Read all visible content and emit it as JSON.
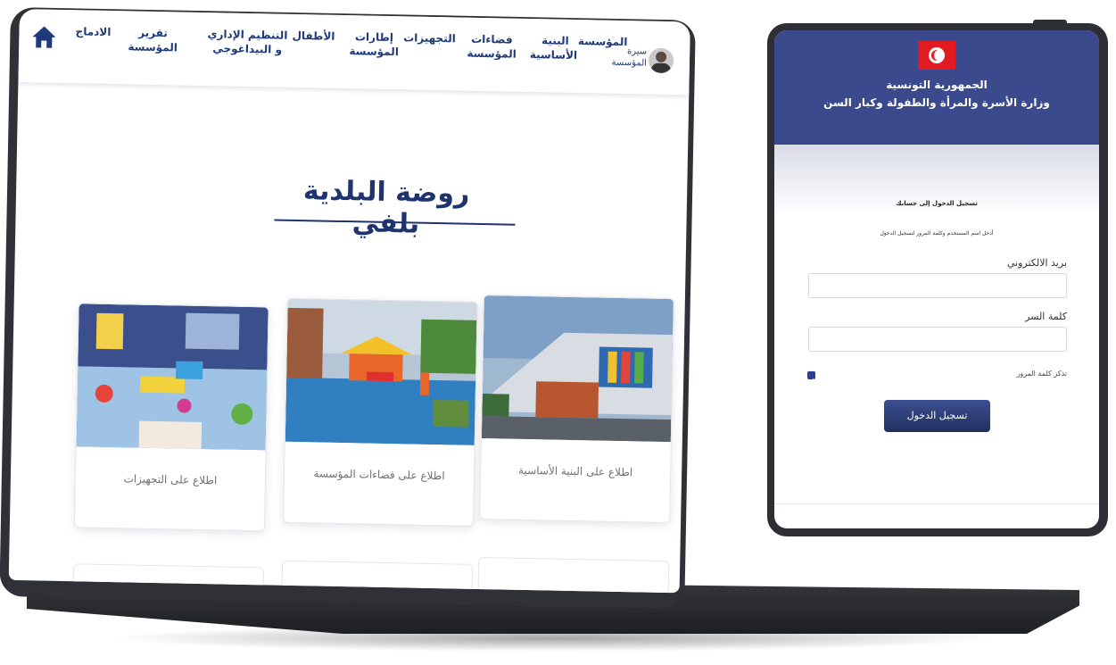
{
  "nav": {
    "items": [
      {
        "label": "الادماج"
      },
      {
        "label": "تقرير المؤسسة"
      },
      {
        "label": "التنظيم الإداري و البيداغوجي"
      },
      {
        "label": "الأطفال"
      },
      {
        "label": "إطارات المؤسسة"
      },
      {
        "label": "التجهيزات"
      },
      {
        "label": "فضاءات المؤسسة"
      },
      {
        "label": "البنية الأساسية"
      },
      {
        "label": "المؤسسة"
      }
    ],
    "user_name": "سيرة المؤسسة"
  },
  "page": {
    "title": "روضة البلدية بلفي"
  },
  "cards": [
    {
      "label": "اطلاع على التجهيزات"
    },
    {
      "label": "اطلاع على فضاءات المؤسسة"
    },
    {
      "label": "اطلاع على البنية الأساسية"
    }
  ],
  "login": {
    "republic": "الجمهورية التونسية",
    "ministry": "وزارة الأسرة والمرأة والطفولة وكبار السن",
    "title": "تسجيل الدخول إلى حسابك",
    "subtitle": "أدخل اسم المستخدم وكلمة المرور لتسجيل الدخول",
    "email_label": "بريد الالكتروني",
    "password_label": "كلمة السر",
    "remember_label": "تذكر كلمة المرور",
    "submit_label": "تسجيل الدخول"
  },
  "colors": {
    "brand_blue": "#1e3370",
    "header_blue": "#3b4a8c",
    "flag_red": "#e21b22"
  }
}
